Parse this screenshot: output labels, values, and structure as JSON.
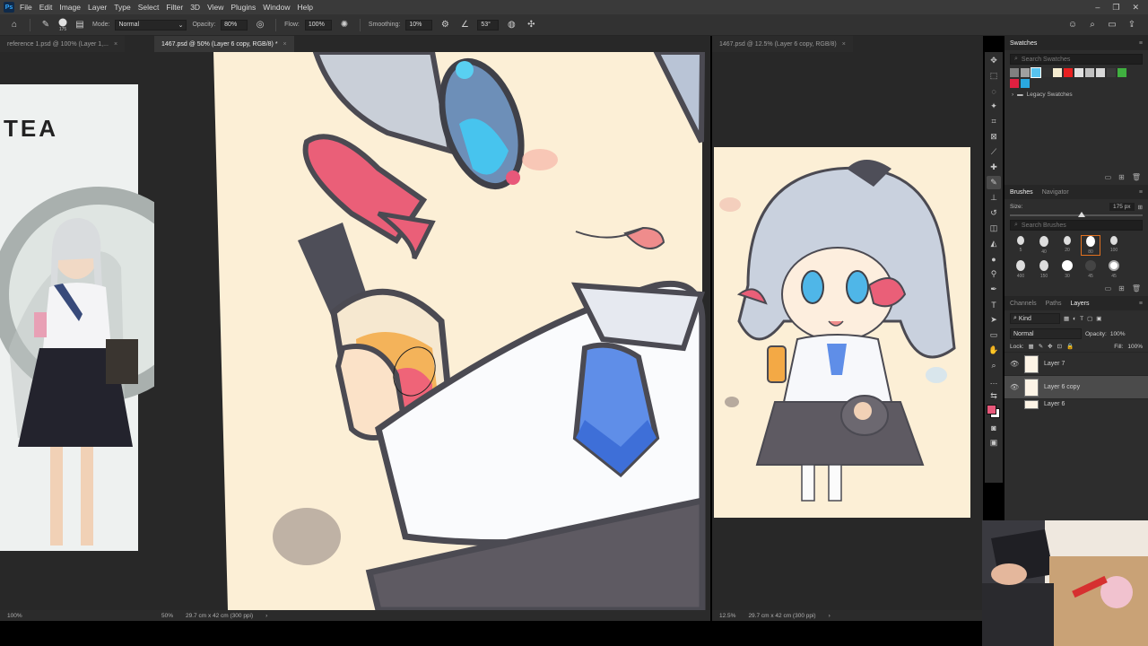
{
  "app": {
    "logo": "Ps"
  },
  "menu": [
    "File",
    "Edit",
    "Image",
    "Layer",
    "Type",
    "Select",
    "Filter",
    "3D",
    "View",
    "Plugins",
    "Window",
    "Help"
  ],
  "options": {
    "brush_size": "175",
    "mode_label": "Mode:",
    "mode_value": "Normal",
    "opacity_label": "Opacity:",
    "opacity_value": "80%",
    "flow_label": "Flow:",
    "flow_value": "100%",
    "smoothing_label": "Smoothing:",
    "smoothing_value": "10%",
    "angle_value": "53°"
  },
  "tabs": {
    "left": "reference 1.psd @ 100% (Layer 1,...",
    "center": "1467.psd @ 50% (Layer 6 copy, RGB/8) *",
    "right": "1467.psd @ 12.5% (Layer 6 copy, RGB/8)",
    "close": "×"
  },
  "reference": {
    "sign_text": "TEA"
  },
  "status": {
    "left_zoom": "100%",
    "center_zoom": "50%",
    "center_doc": "29.7 cm x 42 cm (300 ppi)",
    "right_zoom": "12.5%",
    "right_doc": "29.7 cm x 42 cm (300 ppi)"
  },
  "swatches": {
    "title": "Swatches",
    "search_placeholder": "Search Swatches",
    "colors": [
      "#808080",
      "#a0a0a0",
      "#58c4f0",
      "#303030",
      "#f5ecd0",
      "#e82020",
      "#e0e0e0",
      "#c0c0c0",
      "#d8d8d8",
      "#3a3a3a",
      "#40b040",
      "#e02040",
      "#2aa8e0"
    ],
    "folder": "Legacy Swatches"
  },
  "brushes": {
    "tab": "Brushes",
    "tab2": "Navigator",
    "size_label": "Size:",
    "size_value": "175 px",
    "search_placeholder": "Search Brushes",
    "tips": [
      "5",
      "40",
      "20",
      "80",
      "100",
      "400",
      "150",
      "30",
      "45"
    ],
    "extra_tip": "45"
  },
  "layers": {
    "tabs": [
      "Channels",
      "Paths",
      "Layers"
    ],
    "kind": "Kind",
    "blend": "Normal",
    "opacity_label": "Opacity:",
    "opacity_value": "100%",
    "lock_label": "Lock:",
    "fill_label": "Fill:",
    "fill_value": "100%",
    "items": [
      "Layer 7",
      "Layer 6 copy",
      "Layer 6"
    ]
  },
  "colors": {
    "foreground": "#e8587a",
    "background": "#ffffff",
    "accent": "#31a8ff"
  }
}
